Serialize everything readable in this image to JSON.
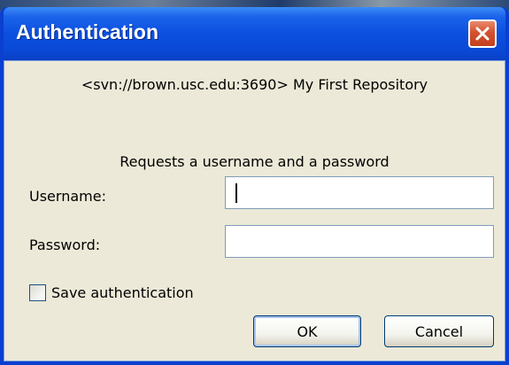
{
  "window": {
    "title": "Authentication",
    "close_icon": "close-icon"
  },
  "dialog": {
    "repository": "<svn://brown.usc.edu:3690> My First Repository",
    "request": "Requests a username and a password"
  },
  "form": {
    "username_label": "Username:",
    "username_value": "",
    "password_label": "Password:",
    "password_value": "",
    "save_label": "Save authentication",
    "save_checked": false
  },
  "buttons": {
    "ok": "OK",
    "cancel": "Cancel"
  },
  "colors": {
    "titlebar": "#0a48d4",
    "client_bg": "#ece9d8",
    "close_button": "#d4522f"
  }
}
